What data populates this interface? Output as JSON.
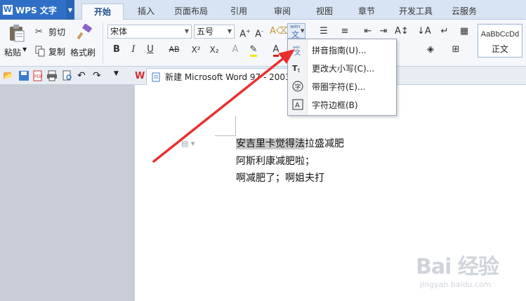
{
  "app": {
    "title": "WPS 文字"
  },
  "tabs": [
    {
      "label": "开始",
      "active": true
    },
    {
      "label": "插入",
      "active": false
    },
    {
      "label": "页面布局",
      "active": false
    },
    {
      "label": "引用",
      "active": false
    },
    {
      "label": "审阅",
      "active": false
    },
    {
      "label": "视图",
      "active": false
    },
    {
      "label": "章节",
      "active": false
    },
    {
      "label": "开发工具",
      "active": false
    },
    {
      "label": "云服务",
      "active": false
    }
  ],
  "clipboard": {
    "paste_label": "粘贴",
    "cut_label": "剪切",
    "copy_label": "复制",
    "format_painter_label": "格式刷"
  },
  "font": {
    "family": "宋体",
    "size": "五号"
  },
  "format_buttons": {
    "bold": "B",
    "italic": "I",
    "underline": "U",
    "strikethrough": "AB",
    "superscript": "X²",
    "subscript": "X₂"
  },
  "styles": {
    "sample": "AaBbCcDd",
    "name": "正文"
  },
  "pinyin_button": {
    "top": "wén",
    "char": "文"
  },
  "document_tab": {
    "label": "新建 Microsoft Word 97 - 2003"
  },
  "menu": {
    "items": [
      {
        "label": "拼音指南(U)...",
        "icon": "pinyin-icon"
      },
      {
        "label": "更改大小写(C)...",
        "icon": "change-case-icon"
      },
      {
        "label": "带圈字符(E)...",
        "icon": "enclosed-char-icon"
      },
      {
        "label": "字符边框(B)",
        "icon": "char-border-icon"
      }
    ]
  },
  "document": {
    "lines": [
      {
        "selected": "安吉里卡觉得法",
        "rest": "拉盛减肥"
      },
      {
        "selected": "",
        "rest": "阿斯利康减肥啦；"
      },
      {
        "selected": "",
        "rest": "啊减肥了；啊姐夫打"
      }
    ]
  },
  "watermark": {
    "brand": "Bai 经验",
    "url": "jingyan.baidu.com"
  },
  "colors": {
    "app_blue": "#2f6fc6",
    "annotation_arrow": "#e8312f",
    "selection": "#c9c9c9"
  }
}
